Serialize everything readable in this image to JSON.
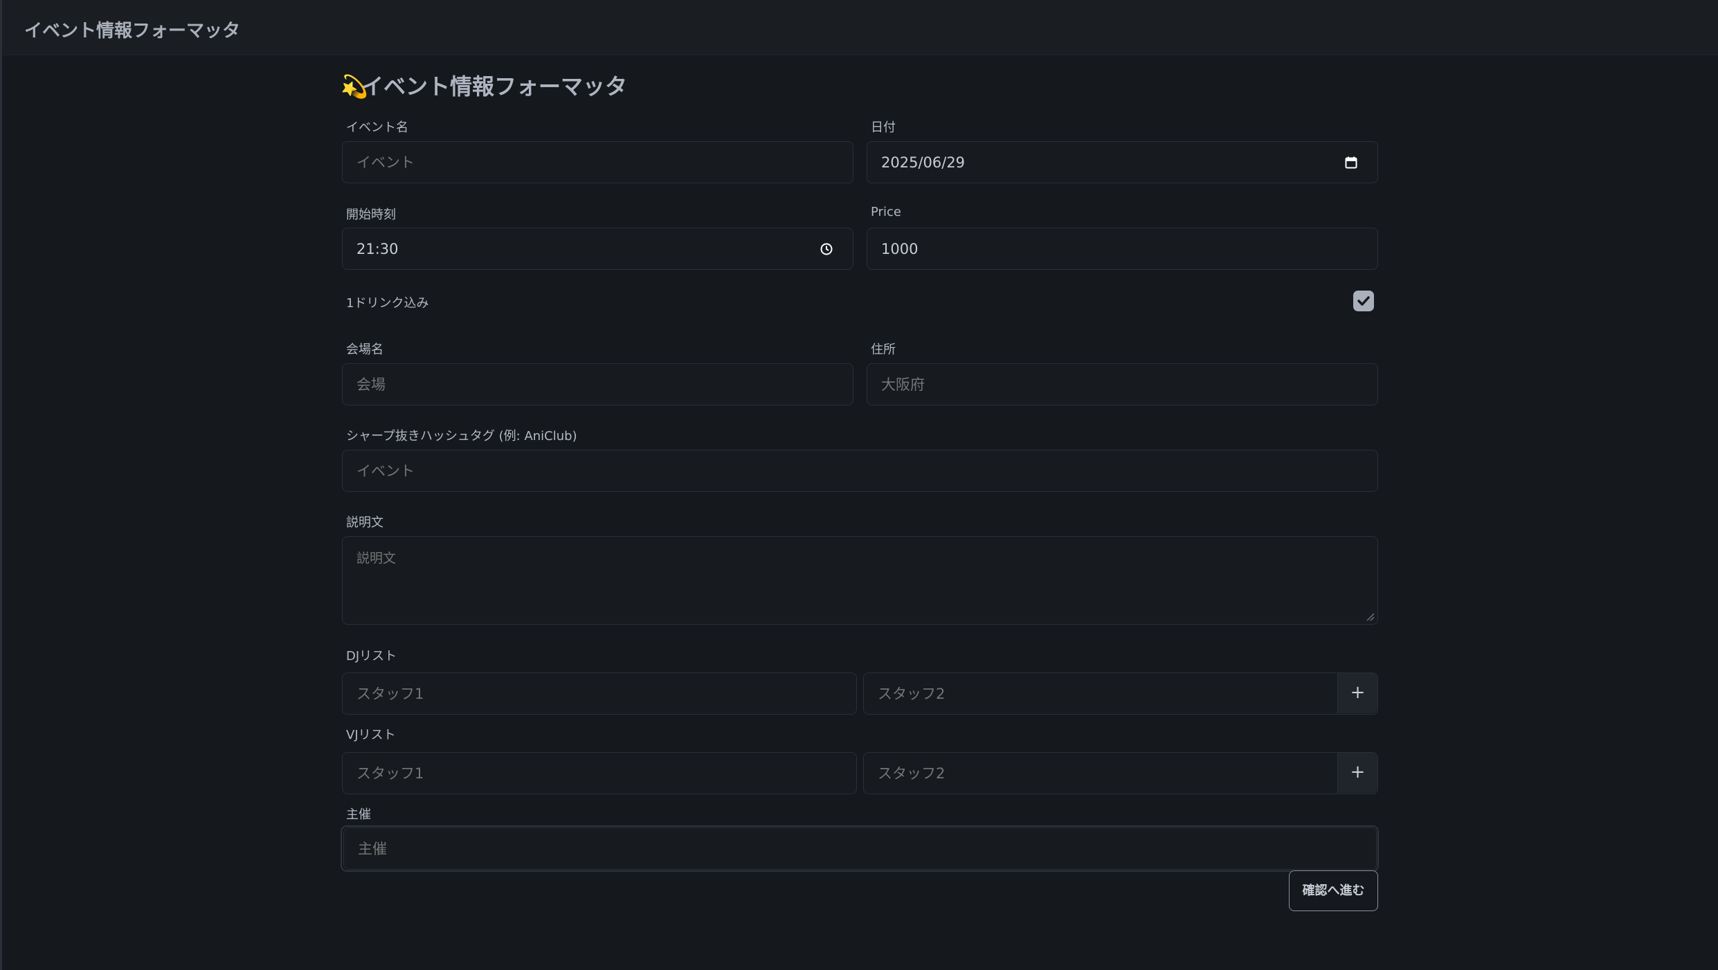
{
  "app": {
    "title": "イベント情報フォーマッタ"
  },
  "page": {
    "emoji": "💫",
    "title": "イベント情報フォーマッタ"
  },
  "form": {
    "event_name": {
      "label": "イベント名",
      "placeholder": "イベント"
    },
    "date": {
      "label": "日付",
      "value": "2025/06/29",
      "icon": "calendar-icon"
    },
    "start_time": {
      "label": "開始時刻",
      "value": "21:30",
      "icon": "clock-icon"
    },
    "price": {
      "label": "Price",
      "value": "1000"
    },
    "drink": {
      "label": "1ドリンク込み",
      "checked": true
    },
    "venue": {
      "label": "会場名",
      "placeholder": "会場"
    },
    "address": {
      "label": "住所",
      "placeholder": "大阪府"
    },
    "hashtag": {
      "label": "シャープ抜きハッシュタグ (例: AniClub)",
      "placeholder": "イベント"
    },
    "description": {
      "label": "説明文",
      "placeholder": "説明文"
    },
    "dj_list": {
      "label": "DJリスト",
      "staff1": "スタッフ1",
      "staff2": "スタッフ2",
      "add": "+"
    },
    "vj_list": {
      "label": "VJリスト",
      "staff1": "スタッフ1",
      "staff2": "スタッフ2",
      "add": "+"
    },
    "organizer": {
      "label": "主催",
      "placeholder": "主催"
    },
    "confirm_button": "確認へ進む"
  },
  "colors": {
    "background": "#15181d",
    "topbar": "#1a1d22",
    "field_border": "#2a2f37",
    "text": "#c9ced6",
    "checkbox": "#a9b0bb"
  }
}
